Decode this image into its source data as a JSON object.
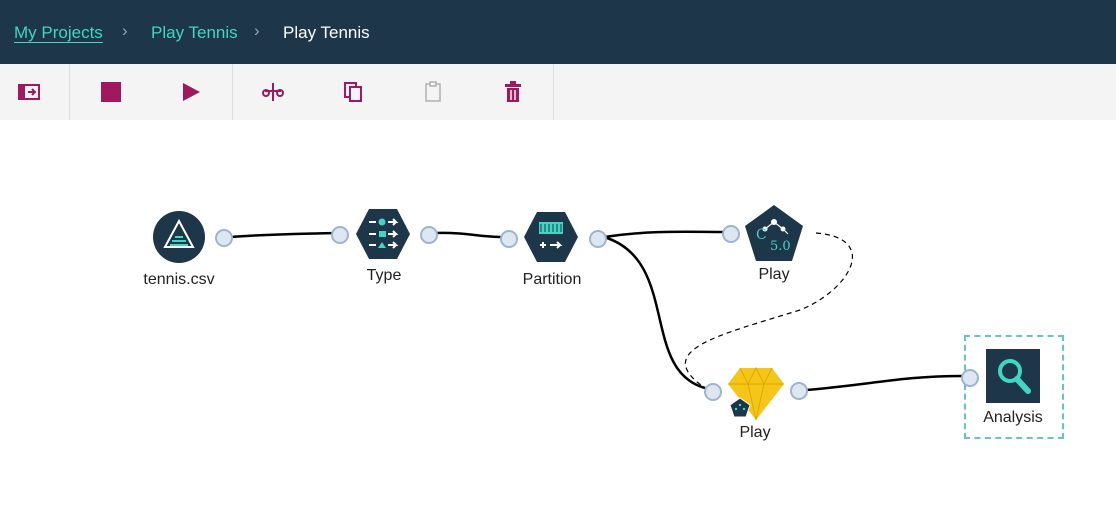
{
  "breadcrumb": {
    "items": [
      "My Projects",
      "Play Tennis",
      "Play Tennis"
    ]
  },
  "toolbar": {
    "buttons": [
      {
        "icon": "toggle-palette-icon",
        "label": "Toggle palette"
      },
      {
        "icon": "stop-icon",
        "label": "Stop"
      },
      {
        "icon": "run-icon",
        "label": "Run"
      },
      {
        "icon": "cut-icon",
        "label": "Cut"
      },
      {
        "icon": "copy-icon",
        "label": "Copy"
      },
      {
        "icon": "paste-icon",
        "label": "Paste",
        "disabled": true
      },
      {
        "icon": "delete-icon",
        "label": "Delete"
      }
    ],
    "icon_color": "#a0195e",
    "disabled_color": "#b0b0b0"
  },
  "flow": {
    "nodes": [
      {
        "id": "tennis-csv",
        "label": "tennis.csv",
        "icon": "data-asset-icon"
      },
      {
        "id": "type",
        "label": "Type",
        "icon": "type-icon"
      },
      {
        "id": "partition",
        "label": "Partition",
        "icon": "partition-icon"
      },
      {
        "id": "c50",
        "label": "Play",
        "icon": "c50-model-icon",
        "icon_text": "5.0",
        "icon_letter": "C"
      },
      {
        "id": "nugget",
        "label": "Play",
        "icon": "model-nugget-icon"
      },
      {
        "id": "analysis",
        "label": "Analysis",
        "icon": "analysis-icon",
        "selected": true
      }
    ],
    "colors": {
      "node": "#1d3649",
      "accent": "#41d6c3",
      "nugget": "#f5c518",
      "selection": "#5fc8c0"
    }
  }
}
